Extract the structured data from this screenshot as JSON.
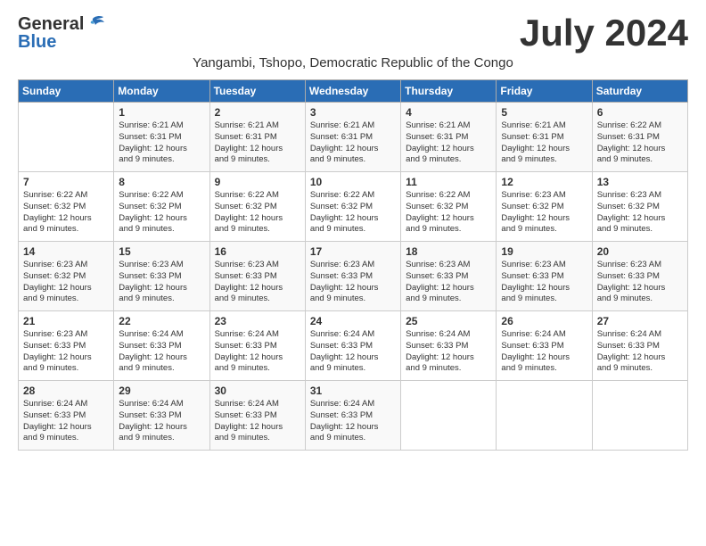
{
  "header": {
    "logo_general": "General",
    "logo_blue": "Blue",
    "month_title": "July 2024",
    "location": "Yangambi, Tshopo, Democratic Republic of the Congo"
  },
  "days_of_week": [
    "Sunday",
    "Monday",
    "Tuesday",
    "Wednesday",
    "Thursday",
    "Friday",
    "Saturday"
  ],
  "weeks": [
    [
      {
        "day": "",
        "info": ""
      },
      {
        "day": "1",
        "info": "Sunrise: 6:21 AM\nSunset: 6:31 PM\nDaylight: 12 hours\nand 9 minutes."
      },
      {
        "day": "2",
        "info": "Sunrise: 6:21 AM\nSunset: 6:31 PM\nDaylight: 12 hours\nand 9 minutes."
      },
      {
        "day": "3",
        "info": "Sunrise: 6:21 AM\nSunset: 6:31 PM\nDaylight: 12 hours\nand 9 minutes."
      },
      {
        "day": "4",
        "info": "Sunrise: 6:21 AM\nSunset: 6:31 PM\nDaylight: 12 hours\nand 9 minutes."
      },
      {
        "day": "5",
        "info": "Sunrise: 6:21 AM\nSunset: 6:31 PM\nDaylight: 12 hours\nand 9 minutes."
      },
      {
        "day": "6",
        "info": "Sunrise: 6:22 AM\nSunset: 6:31 PM\nDaylight: 12 hours\nand 9 minutes."
      }
    ],
    [
      {
        "day": "7",
        "info": "Sunrise: 6:22 AM\nSunset: 6:32 PM\nDaylight: 12 hours\nand 9 minutes."
      },
      {
        "day": "8",
        "info": "Sunrise: 6:22 AM\nSunset: 6:32 PM\nDaylight: 12 hours\nand 9 minutes."
      },
      {
        "day": "9",
        "info": "Sunrise: 6:22 AM\nSunset: 6:32 PM\nDaylight: 12 hours\nand 9 minutes."
      },
      {
        "day": "10",
        "info": "Sunrise: 6:22 AM\nSunset: 6:32 PM\nDaylight: 12 hours\nand 9 minutes."
      },
      {
        "day": "11",
        "info": "Sunrise: 6:22 AM\nSunset: 6:32 PM\nDaylight: 12 hours\nand 9 minutes."
      },
      {
        "day": "12",
        "info": "Sunrise: 6:23 AM\nSunset: 6:32 PM\nDaylight: 12 hours\nand 9 minutes."
      },
      {
        "day": "13",
        "info": "Sunrise: 6:23 AM\nSunset: 6:32 PM\nDaylight: 12 hours\nand 9 minutes."
      }
    ],
    [
      {
        "day": "14",
        "info": "Sunrise: 6:23 AM\nSunset: 6:32 PM\nDaylight: 12 hours\nand 9 minutes."
      },
      {
        "day": "15",
        "info": "Sunrise: 6:23 AM\nSunset: 6:33 PM\nDaylight: 12 hours\nand 9 minutes."
      },
      {
        "day": "16",
        "info": "Sunrise: 6:23 AM\nSunset: 6:33 PM\nDaylight: 12 hours\nand 9 minutes."
      },
      {
        "day": "17",
        "info": "Sunrise: 6:23 AM\nSunset: 6:33 PM\nDaylight: 12 hours\nand 9 minutes."
      },
      {
        "day": "18",
        "info": "Sunrise: 6:23 AM\nSunset: 6:33 PM\nDaylight: 12 hours\nand 9 minutes."
      },
      {
        "day": "19",
        "info": "Sunrise: 6:23 AM\nSunset: 6:33 PM\nDaylight: 12 hours\nand 9 minutes."
      },
      {
        "day": "20",
        "info": "Sunrise: 6:23 AM\nSunset: 6:33 PM\nDaylight: 12 hours\nand 9 minutes."
      }
    ],
    [
      {
        "day": "21",
        "info": "Sunrise: 6:23 AM\nSunset: 6:33 PM\nDaylight: 12 hours\nand 9 minutes."
      },
      {
        "day": "22",
        "info": "Sunrise: 6:24 AM\nSunset: 6:33 PM\nDaylight: 12 hours\nand 9 minutes."
      },
      {
        "day": "23",
        "info": "Sunrise: 6:24 AM\nSunset: 6:33 PM\nDaylight: 12 hours\nand 9 minutes."
      },
      {
        "day": "24",
        "info": "Sunrise: 6:24 AM\nSunset: 6:33 PM\nDaylight: 12 hours\nand 9 minutes."
      },
      {
        "day": "25",
        "info": "Sunrise: 6:24 AM\nSunset: 6:33 PM\nDaylight: 12 hours\nand 9 minutes."
      },
      {
        "day": "26",
        "info": "Sunrise: 6:24 AM\nSunset: 6:33 PM\nDaylight: 12 hours\nand 9 minutes."
      },
      {
        "day": "27",
        "info": "Sunrise: 6:24 AM\nSunset: 6:33 PM\nDaylight: 12 hours\nand 9 minutes."
      }
    ],
    [
      {
        "day": "28",
        "info": "Sunrise: 6:24 AM\nSunset: 6:33 PM\nDaylight: 12 hours\nand 9 minutes."
      },
      {
        "day": "29",
        "info": "Sunrise: 6:24 AM\nSunset: 6:33 PM\nDaylight: 12 hours\nand 9 minutes."
      },
      {
        "day": "30",
        "info": "Sunrise: 6:24 AM\nSunset: 6:33 PM\nDaylight: 12 hours\nand 9 minutes."
      },
      {
        "day": "31",
        "info": "Sunrise: 6:24 AM\nSunset: 6:33 PM\nDaylight: 12 hours\nand 9 minutes."
      },
      {
        "day": "",
        "info": ""
      },
      {
        "day": "",
        "info": ""
      },
      {
        "day": "",
        "info": ""
      }
    ]
  ]
}
